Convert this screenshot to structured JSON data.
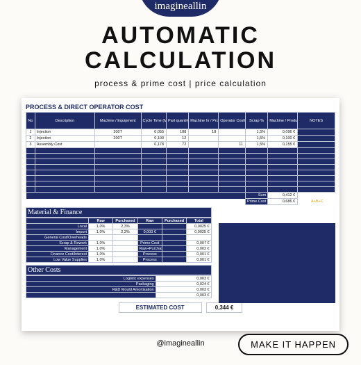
{
  "brand": {
    "name": "imagineallin",
    "handle": "@imagineallin"
  },
  "title_line1": "AUTOMATIC",
  "title_line2": "CALCULATION",
  "subtitle": "process & prime cost | price calculation",
  "cta": "MAKE IT HAPPEN",
  "sheet": {
    "section_title": "PROCESS & DIRECT OPERATOR COST",
    "headers": {
      "no": "No",
      "desc": "Description",
      "mach": "Machine / Equipment",
      "ct": "Cycle Time (Mn)",
      "pq": "Part quantity Pc.",
      "mhr": "Machine hr / Production cost/Shr.",
      "op": "Operator Cost/Shr.",
      "scr": "Scrap %",
      "mpc": "Machine / Production Cost/P",
      "note": "NOTES"
    },
    "rows": [
      {
        "no": "1",
        "desc": "Injection",
        "mach": "300T",
        "ct": "0,055",
        "pq": "188",
        "mhr": "18",
        "op": "",
        "scr": "1,5%",
        "mpc": "0,096 €"
      },
      {
        "no": "2",
        "desc": "Injection",
        "mach": "200T",
        "ct": "0,100",
        "pq": "12",
        "mhr": "",
        "op": "",
        "scr": "1,5%",
        "mpc": "0,100 €"
      },
      {
        "no": "3",
        "desc": "Assembly Cost",
        "mach": "",
        "ct": "0,178",
        "pq": "72",
        "mhr": "",
        "op": "11",
        "scr": "1,5%",
        "mpc": "0,155 €"
      }
    ],
    "blank_rows": 8,
    "sum_label": "Sum",
    "sum_value": "0,412 €",
    "prime_label": "Prime Cost",
    "prime_value": "0,686 €",
    "abc_note": "A+B+C",
    "mat_title": "Material & Finance",
    "mat_headers": {
      "raw": "Raw",
      "purch": "Purchased",
      "raw2": "Raw",
      "purch2": "Purchased",
      "total": "Total"
    },
    "mat_rows": [
      {
        "label": "Local",
        "raw": "1,0%",
        "purch": "2,3%",
        "raw2": "",
        "purch2": "",
        "total": "0,0025 €"
      },
      {
        "label": "Import",
        "raw": "1,0%",
        "purch": "2,3%",
        "raw2": "0,000 €",
        "purch2": "",
        "total": "0,0025 €"
      },
      {
        "label": "General Cost/Overheads",
        "raw": "",
        "purch": "",
        "raw2": "",
        "purch2": "",
        "total": ""
      },
      {
        "label": "Scrap & Rework",
        "raw": "1,0%",
        "purch": "",
        "raw2": "Prime Cost",
        "purch2": "",
        "total": "0,007 €"
      },
      {
        "label": "Management",
        "raw": "1,0%",
        "purch": "",
        "raw2": "Raw+Purchased",
        "purch2": "",
        "total": "0,002 €"
      },
      {
        "label": "Finance Cost/Interest",
        "raw": "1,0%",
        "purch": "",
        "raw2": "Process",
        "purch2": "",
        "total": "0,001 €"
      },
      {
        "label": "Low Value Supplies",
        "raw": "1,0%",
        "purch": "",
        "raw2": "Process",
        "purch2": "",
        "total": "0,001 €"
      }
    ],
    "other_title": "Other Costs",
    "other_rows": [
      {
        "label": "Logistic expenses",
        "total": "0,003 €"
      },
      {
        "label": "Packaging",
        "total": "0,024 €"
      },
      {
        "label": "R&D Mould Amortisation",
        "total": "0,003 €"
      },
      {
        "label": "",
        "total": "0,003 €"
      }
    ],
    "estimate_label": "ESTIMATED COST",
    "estimate_value": "0,344 €"
  }
}
